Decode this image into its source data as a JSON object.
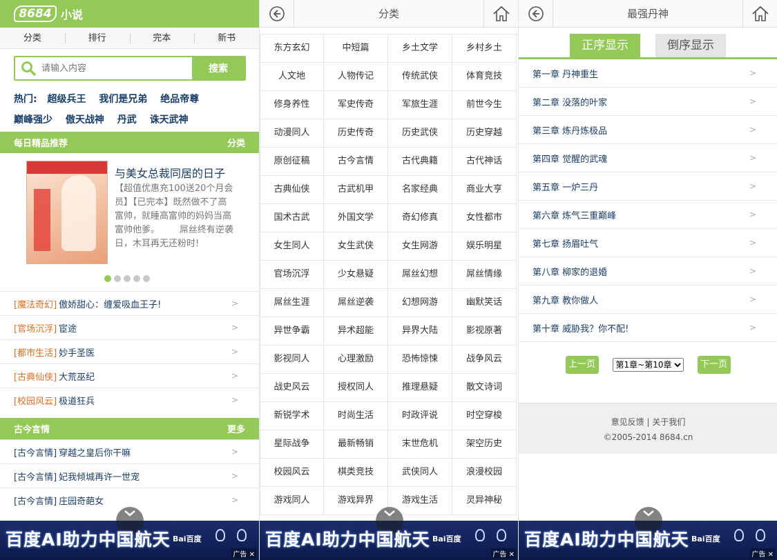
{
  "p1": {
    "logo": "8684",
    "logo_sub": "小说",
    "nav": [
      "分类",
      "排行",
      "完本",
      "新书"
    ],
    "search_placeholder": "请输入内容",
    "search_button": "搜索",
    "hot_label": "热门:",
    "hot_row1": [
      "超级兵王",
      "我们是兄弟",
      "绝品帝尊"
    ],
    "hot_row2": [
      "巅峰强少",
      "傲天战神",
      "丹武",
      "诛天武神"
    ],
    "daily": {
      "title": "每日精品推荐",
      "more": "分类"
    },
    "feature": {
      "title": "与美女总裁同居的日子",
      "desc": "【超值优惠充100送20个月会员】【已完本】既然做不了高富帅，就睡高富帅的妈妈当高富帅他爹。       屌丝终有逆袭日，木耳再无还粉时!"
    },
    "carousel": {
      "count": 5,
      "active": 0
    },
    "recommend": [
      {
        "cat": "[魔法奇幻]",
        "title": "傲娇甜心：缠爱吸血王子!"
      },
      {
        "cat": "[官场沉浮]",
        "title": "宦途"
      },
      {
        "cat": "[都市生活]",
        "title": "妙手圣医"
      },
      {
        "cat": "[古典仙侠]",
        "title": "大荒巫纪"
      },
      {
        "cat": "[校园风云]",
        "title": "极道狂兵"
      }
    ],
    "section2": {
      "title": "古今言情",
      "more": "更多"
    },
    "list2": [
      {
        "cat": "[古今言情]",
        "title": "穿越之皇后你干嘛"
      },
      {
        "cat": "[古今言情]",
        "title": "妃我倾城再许一世宠"
      },
      {
        "cat": "[古今言情]",
        "title": "庄园奇葩女"
      }
    ],
    "arrow": ">"
  },
  "p2": {
    "title": "分类",
    "categories": [
      "东方玄幻",
      "中短篇",
      "乡土文学",
      "乡村乡土",
      "人文地",
      "人物传记",
      "传统武侠",
      "体育竞技",
      "修身养性",
      "军史传奇",
      "军旅生涯",
      "前世今生",
      "动漫同人",
      "历史传奇",
      "历史武侠",
      "历史穿越",
      "原创征稿",
      "古今言情",
      "古代典籍",
      "古代神话",
      "古典仙侠",
      "古武机甲",
      "名家经典",
      "商业大亨",
      "国术古武",
      "外国文学",
      "奇幻修真",
      "女性都市",
      "女生同人",
      "女生武侠",
      "女生网游",
      "娱乐明星",
      "官场沉浮",
      "少女悬疑",
      "屌丝幻想",
      "屌丝情缘",
      "屌丝生涯",
      "屌丝逆袭",
      "幻想网游",
      "幽默笑话",
      "异世争霸",
      "异术超能",
      "异界大陆",
      "影视原著",
      "影视同人",
      "心理激励",
      "恐怖惊悚",
      "战争风云",
      "战史风云",
      "授权同人",
      "推理悬疑",
      "散文诗词",
      "新锐学术",
      "时尚生活",
      "时政评说",
      "时空穿梭",
      "星际战争",
      "最新畅销",
      "末世危机",
      "架空历史",
      "校园风云",
      "棋类竞技",
      "武侠同人",
      "浪漫校园",
      "游戏同人",
      "游戏异界",
      "游戏生活",
      "灵异神秘"
    ]
  },
  "p3": {
    "title": "最强丹神",
    "tab_asc": "正序显示",
    "tab_desc": "倒序显示",
    "chapters": [
      "第一章 丹神重生",
      "第二章 没落的叶家",
      "第三章 炼丹炼极品",
      "第四章 觉醒的武魂",
      "第五章 一炉三丹",
      "第六章 炼气三重巅峰",
      "第七章 扬眉吐气",
      "第八章 柳家的退婚",
      "第九章 教你做人",
      "第十章 威胁我？你不配!"
    ],
    "prev": "上一页",
    "next": "下一页",
    "page_select": "第1章~第10章",
    "footer_links": [
      "意见反馈",
      "关于我们"
    ],
    "footer_sep": "|",
    "copyright": "©2005-2014 8684.cn"
  },
  "ad": {
    "text": "百度AI助力中国航天",
    "brand": "Bai百度",
    "tag": "广告",
    "close": "✕"
  },
  "colors": {
    "accent": "#93c957",
    "link": "#1a3e6a",
    "category": "#e56c1e"
  },
  "icons": [
    "search-icon",
    "back-icon",
    "home-icon",
    "chevron-down-icon"
  ]
}
